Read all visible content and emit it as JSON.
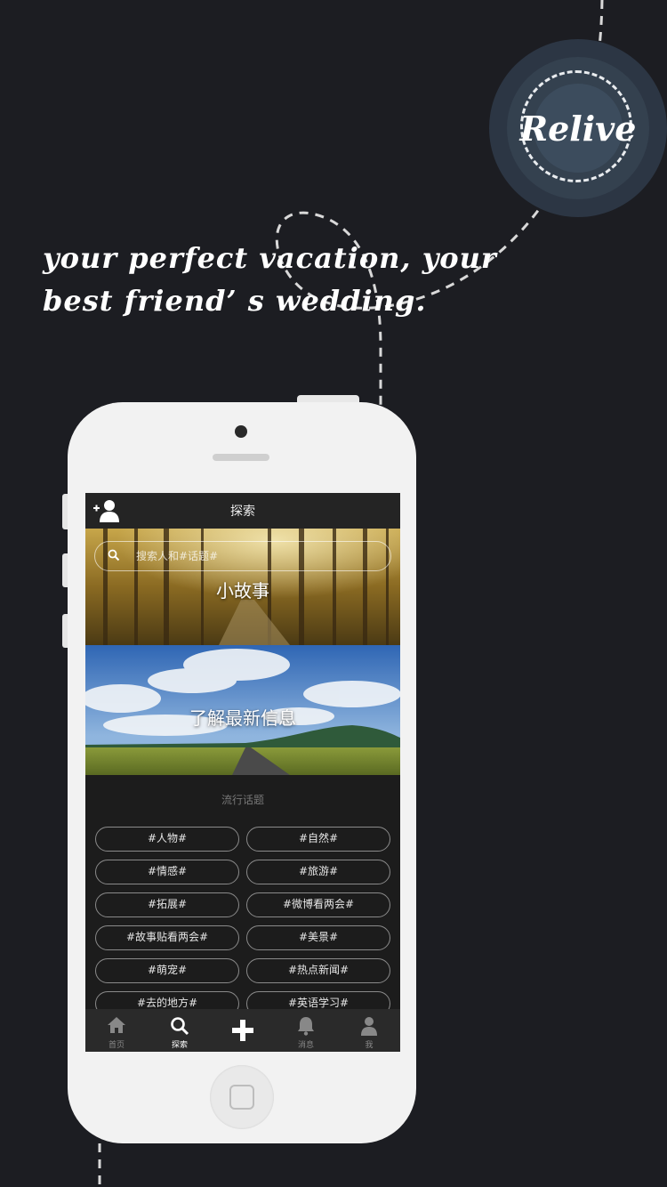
{
  "brand": {
    "logo_text": "Relive"
  },
  "tagline": {
    "line1": "your perfect vacation, your",
    "line2": "best friend’ s wedding."
  },
  "app": {
    "header_title": "探索",
    "search_placeholder": "搜索人和#话题#",
    "banners": [
      {
        "label": "小故事"
      },
      {
        "label": "了解最新信息"
      }
    ],
    "trending_title": "流行话题",
    "tags": [
      "#人物#",
      "#自然#",
      "#情感#",
      "#旅游#",
      "#拓展#",
      "#微博看两会#",
      "#故事贴看两会#",
      "#美景#",
      "#萌宠#",
      "#热点新闻#",
      "#去的地方#",
      "#英语学习#"
    ],
    "tabs": [
      {
        "label": "首页",
        "icon": "home-icon"
      },
      {
        "label": "探索",
        "icon": "search-icon",
        "active": true
      },
      {
        "label": "",
        "icon": "plus-icon"
      },
      {
        "label": "消息",
        "icon": "bell-icon"
      },
      {
        "label": "我",
        "icon": "user-icon"
      }
    ]
  },
  "colors": {
    "background": "#1c1d22",
    "phone_body": "#f2f2f2",
    "logo": "#34414f"
  }
}
